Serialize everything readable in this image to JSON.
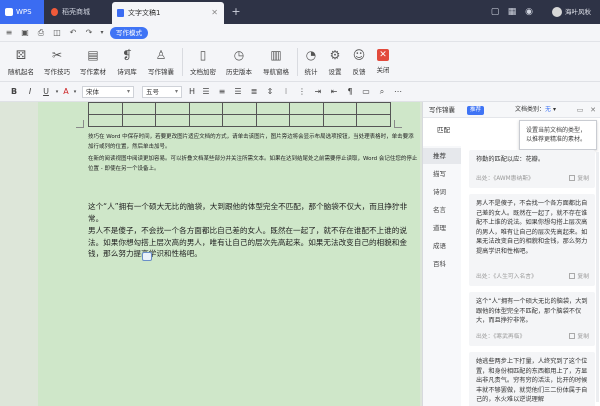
{
  "titlebar": {
    "tabs": [
      {
        "label": "WPS"
      },
      {
        "label": "稻壳商城"
      },
      {
        "label": "文字文稿1"
      }
    ],
    "user": "海叶风秋"
  },
  "quickbar": {
    "mode_label": "写作模式"
  },
  "ribbon": {
    "items": [
      {
        "label": "随机起名",
        "icon": "dice-icon"
      },
      {
        "label": "写作技巧",
        "icon": "crossed-pen-icon"
      },
      {
        "label": "写作素材",
        "icon": "document-icon"
      },
      {
        "label": "诗词库",
        "icon": "poem-book-icon"
      },
      {
        "label": "写作锦囊",
        "icon": "pouch-icon"
      },
      {
        "label": "文档加密",
        "icon": "lock-doc-icon"
      },
      {
        "label": "历史版本",
        "icon": "history-icon"
      },
      {
        "label": "导航窗格",
        "icon": "nav-pane-icon"
      },
      {
        "label": "统计",
        "icon": "pie-chart-icon"
      },
      {
        "label": "设置",
        "icon": "gear-icon"
      },
      {
        "label": "反馈",
        "icon": "feedback-icon"
      },
      {
        "label": "关闭",
        "icon": "close-icon"
      }
    ]
  },
  "formatbar": {
    "font": "宋体",
    "size": "五号"
  },
  "doc": {
    "small_lines": [
      "技巧在 Word 中保存时间，若要更改图片适应文档的方式，请单击该图片，图片旁边将会显示布局选项按钮，当处理表格时，单击要添加行或列的位置，然后单击加号。",
      "在新的阅读视图中阅读更加容易。可以折叠文档某些部分并关注所需文本。如果在达到结尾处之前需要停止读取，Word 会记住您的停止位置 - 即使在另一个设备上。"
    ],
    "para1": "这个“人”拥有一个硕大无比的脑袋，大到跟他的体型完全不匹配，那个脑袋不仅大，而且挣狞非常。",
    "para2": "男人不是傻子，不会找一个各方面都比自己差的女人。既然在一起了，就不存在谁配不上谁的说法。如果你想勾搭上层次高的男人，唯有让自己的层次先高起来。如果无法改变自己的相貌和金钱，那么努力提高学识和性格吧。"
  },
  "panel": {
    "title": "写作锦囊",
    "badge": "推荐",
    "type_label": "文档类别：",
    "type_value": "无",
    "match_label": "匹配",
    "tooltip": "设置当前文档的类型，以推荐更精准的素材。",
    "nav": [
      "推荐",
      "描写",
      "诗词",
      "名言",
      "道理",
      "成语",
      "百科"
    ],
    "cards": [
      {
        "text": "祢勤的匹配以应：花瓣。",
        "source": "出处：《AWM惠纳斯》",
        "copy": "复制"
      },
      {
        "text": "男人不是傻子，不会找一个各方面都比自己差的女人。既然在一起了，就不存在谁配不上谁的说法。如果你想勾搭上层次高的男人，唯有让自己的层次先高起来。如果无法改变自己的相貌和金钱，那么努力提高学识和性格吧。",
        "source": "出处：《人生可入名言》",
        "copy": "复制"
      },
      {
        "text": "这个“人”拥有一个硕大无比的脑袋，大到跟他的体型完全不匹配，那个脑袋不仅大，而且挣狞非常。",
        "source": "出处：《寒武再临》",
        "copy": "复制"
      },
      {
        "text": "她逃些两步上下打量，人终究到了这个位置，和身份相匹配的东西都用上了，方显出非凡贵气。穷有穷的活法，比开的时候丰就不够罢做，就觉他们三二份体属于自己的，水火难以逆说理解"
      }
    ]
  }
}
